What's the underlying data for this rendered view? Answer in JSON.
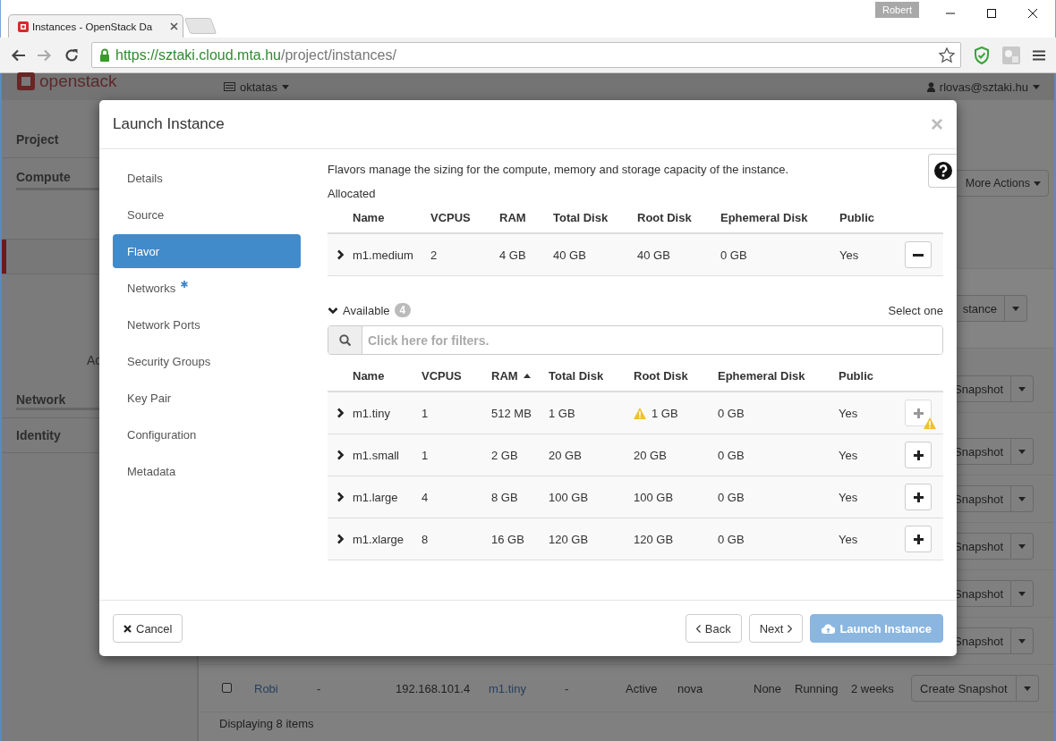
{
  "browser": {
    "tab_title": "Instances - OpenStack Da",
    "profile": "Robert",
    "url_origin": "https://sztaki.cloud.mta.hu",
    "url_path": "/project/instances/"
  },
  "topbar": {
    "logo": "openstack",
    "project": "oktatas",
    "user": "rlovas@sztaki.hu"
  },
  "sidebar": [
    {
      "kind": "panel",
      "label": "Project",
      "selected": false
    },
    {
      "kind": "group",
      "label": "Compute",
      "selected": false
    },
    {
      "kind": "item",
      "selected": true
    },
    {
      "kind": "item",
      "label": "Ac",
      "selected": false
    },
    {
      "kind": "group",
      "label": "Network",
      "selected": false
    },
    {
      "kind": "panel",
      "label": "Identity",
      "selected": false
    }
  ],
  "page": {
    "more_actions": "More Actions",
    "launch_fragment": "stance",
    "row_actions": [
      "Snapshot",
      "Snapshot",
      "Snapshot",
      "Snapshot",
      "Snapshot",
      "Snapshot"
    ],
    "instance_row": {
      "checked": false,
      "name": "Robi",
      "column_3": "-",
      "ip": "192.168.101.4",
      "flavor": "m1.tiny",
      "column_6": "-",
      "status": "Active",
      "zone": "nova",
      "task": "None",
      "power": "Running",
      "age": "2 weeks",
      "action": "Create Snapshot"
    },
    "footer": "Displaying 8 items"
  },
  "modal": {
    "title": "Launch Instance",
    "close": "×",
    "steps": [
      {
        "label": "Details",
        "selected": false,
        "required": false
      },
      {
        "label": "Source",
        "selected": false,
        "required": false
      },
      {
        "label": "Flavor",
        "selected": true,
        "required": false
      },
      {
        "label": "Networks",
        "selected": false,
        "required": true
      },
      {
        "label": "Network Ports",
        "selected": false,
        "required": false
      },
      {
        "label": "Security Groups",
        "selected": false,
        "required": false
      },
      {
        "label": "Key Pair",
        "selected": false,
        "required": false
      },
      {
        "label": "Configuration",
        "selected": false,
        "required": false
      },
      {
        "label": "Metadata",
        "selected": false,
        "required": false
      }
    ],
    "description": "Flavors manage the sizing for the compute, memory and storage capacity of the instance.",
    "allocated_label": "Allocated",
    "allocated_columns": [
      "Name",
      "VCPUS",
      "RAM",
      "Total Disk",
      "Root Disk",
      "Ephemeral Disk",
      "Public"
    ],
    "allocated": [
      {
        "name": "m1.medium",
        "vcpus": "2",
        "ram": "4 GB",
        "total_disk": "40 GB",
        "root_disk": "40 GB",
        "ephemeral_disk": "0 GB",
        "public": "Yes",
        "expanded": false,
        "root_disk_warning": false,
        "disabled": false
      }
    ],
    "available_label": "Available",
    "available_expanded": true,
    "available_count": "4",
    "select_hint": "Select one",
    "filter_placeholder": "Click here for filters.",
    "available_columns": [
      {
        "label": "Name",
        "sorted": false
      },
      {
        "label": "VCPUS",
        "sorted": false
      },
      {
        "label": "RAM",
        "sorted": true
      },
      {
        "label": "Total Disk",
        "sorted": false
      },
      {
        "label": "Root Disk",
        "sorted": false
      },
      {
        "label": "Ephemeral Disk",
        "sorted": false
      },
      {
        "label": "Public",
        "sorted": false
      }
    ],
    "available": [
      {
        "name": "m1.tiny",
        "vcpus": "1",
        "ram": "512 MB",
        "total_disk": "1 GB",
        "root_disk": "1 GB",
        "ephemeral_disk": "0 GB",
        "public": "Yes",
        "expanded": false,
        "root_disk_warning": true,
        "disabled": true
      },
      {
        "name": "m1.small",
        "vcpus": "1",
        "ram": "2 GB",
        "total_disk": "20 GB",
        "root_disk": "20 GB",
        "ephemeral_disk": "0 GB",
        "public": "Yes",
        "expanded": false,
        "root_disk_warning": false,
        "disabled": false
      },
      {
        "name": "m1.large",
        "vcpus": "4",
        "ram": "8 GB",
        "total_disk": "100 GB",
        "root_disk": "100 GB",
        "ephemeral_disk": "0 GB",
        "public": "Yes",
        "expanded": false,
        "root_disk_warning": false,
        "disabled": false
      },
      {
        "name": "m1.xlarge",
        "vcpus": "8",
        "ram": "16 GB",
        "total_disk": "120 GB",
        "root_disk": "120 GB",
        "ephemeral_disk": "0 GB",
        "public": "Yes",
        "expanded": false,
        "root_disk_warning": false,
        "disabled": false
      }
    ],
    "buttons": [
      {
        "kind": "cancel",
        "label": "Cancel",
        "disabled": false
      },
      {
        "kind": "back",
        "label": "Back",
        "disabled": false
      },
      {
        "kind": "next",
        "label": "Next",
        "disabled": false
      },
      {
        "kind": "launch",
        "label": "Launch Instance",
        "disabled": true
      }
    ]
  }
}
